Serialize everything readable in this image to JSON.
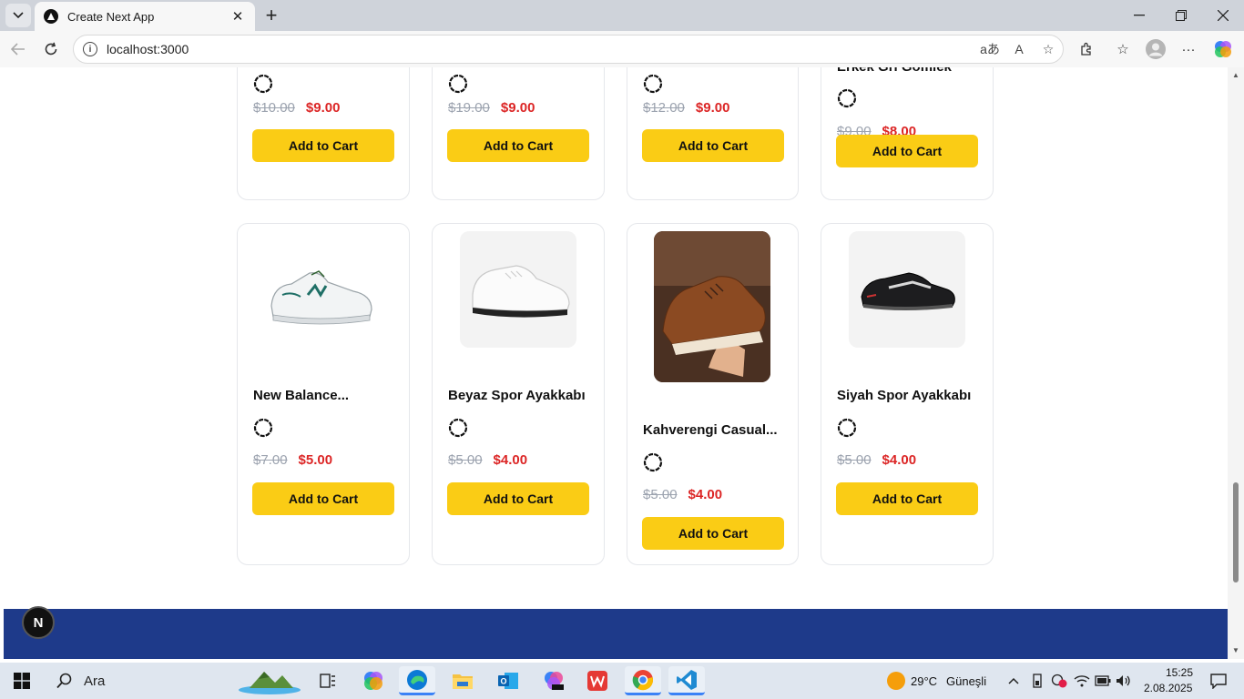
{
  "browser": {
    "tab_title": "Create Next App",
    "url": "localhost:3000",
    "reading_icon": "aあ",
    "read_aloud_icon": "A"
  },
  "products_row1": [
    {
      "old_price": "$10.00",
      "price": "$9.00",
      "button": "Add to Cart"
    },
    {
      "old_price": "$19.00",
      "price": "$9.00",
      "button": "Add to Cart"
    },
    {
      "old_price": "$12.00",
      "price": "$9.00",
      "button": "Add to Cart"
    },
    {
      "name": "Erkek Gri Gömlek",
      "old_price": "$9.00",
      "price": "$8.00",
      "button": "Add to Cart"
    }
  ],
  "products_row2": [
    {
      "name": "New Balance...",
      "old_price": "$7.00",
      "price": "$5.00",
      "button": "Add to Cart",
      "image": "white-green-sneaker"
    },
    {
      "name": "Beyaz Spor Ayakkabı",
      "old_price": "$5.00",
      "price": "$4.00",
      "button": "Add to Cart",
      "image": "white-sneaker"
    },
    {
      "name": "Kahverengi Casual...",
      "old_price": "$5.00",
      "price": "$4.00",
      "button": "Add to Cart",
      "image": "brown-casual-shoe"
    },
    {
      "name": "Siyah Spor Ayakkabı",
      "old_price": "$5.00",
      "price": "$4.00",
      "button": "Add to Cart",
      "image": "black-sneaker"
    }
  ],
  "next_badge": "N",
  "taskbar": {
    "search_placeholder": "Ara",
    "weather_temp": "29°C",
    "weather_text": "Güneşli",
    "time": "15:25",
    "date": "2.08.2025"
  },
  "colors": {
    "accent_button": "#facc15",
    "sale_price": "#dc2626",
    "footer": "#1e3a8a"
  }
}
